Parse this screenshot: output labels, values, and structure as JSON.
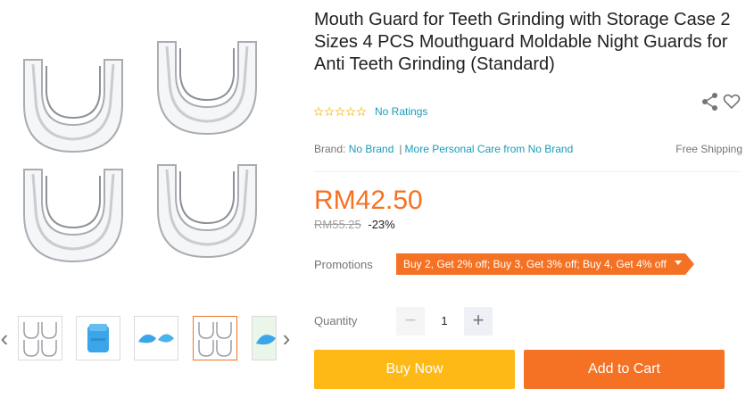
{
  "product": {
    "title": "Mouth Guard for Teeth Grinding with Storage Case 2 Sizes 4 PCS Mouthguard Moldable Night Guards for Anti Teeth Grinding (Standard)",
    "ratings_text": "No Ratings",
    "rating": 0,
    "brand_label": "Brand:",
    "brand": "No Brand",
    "more_link": "More Personal Care from No Brand",
    "shipping": "Free Shipping",
    "price": "RM42.50",
    "original_price": "RM55.25",
    "discount": "-23%"
  },
  "promotions": {
    "label": "Promotions",
    "text": "Buy 2, Get 2% off; Buy 3, Get 3% off; Buy 4, Get 4% off"
  },
  "quantity": {
    "label": "Quantity",
    "value": "1",
    "minus": "−",
    "plus": "+"
  },
  "actions": {
    "buy_now": "Buy Now",
    "add_to_cart": "Add to Cart"
  },
  "gallery": {
    "prev": "‹",
    "next": "›"
  },
  "colors": {
    "accent": "#f57224",
    "buy": "#ffb916",
    "link": "#1a9cb7"
  }
}
